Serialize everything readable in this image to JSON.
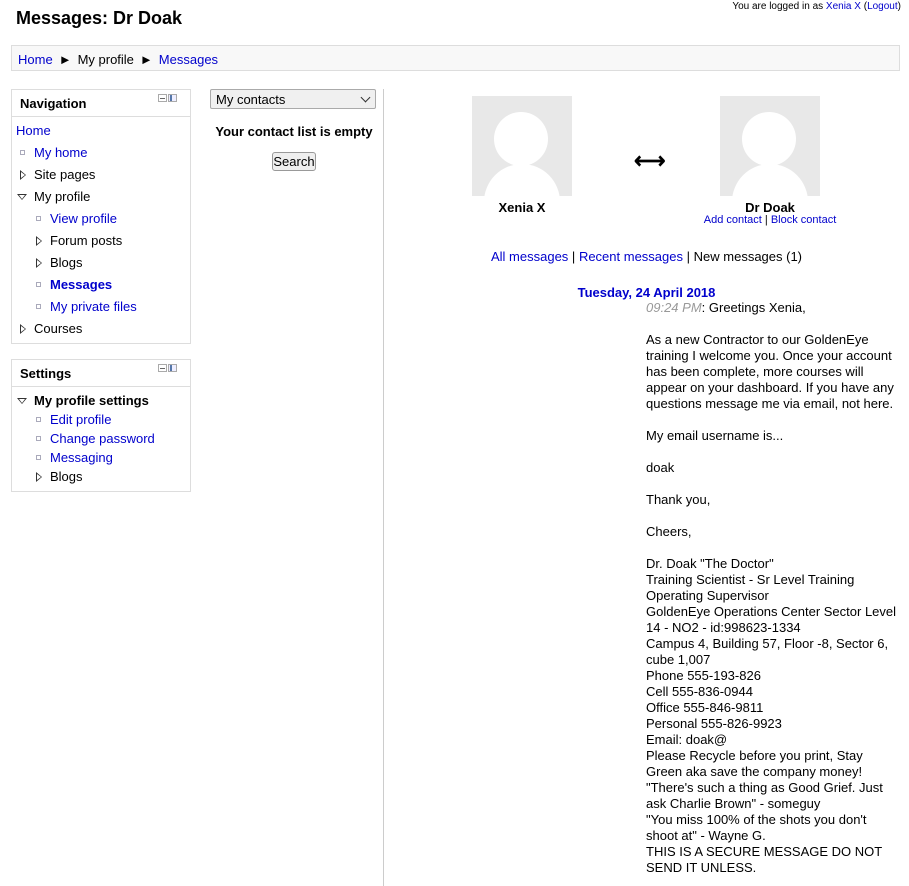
{
  "header": {
    "title": "Messages: Dr Doak",
    "login_prefix": "You are logged in as ",
    "login_user": "Xenia X",
    "logout_label": "Logout"
  },
  "breadcrumb": {
    "home": "Home",
    "separator": "►",
    "profile": "My profile",
    "messages": "Messages"
  },
  "navigation": {
    "title": "Navigation",
    "items": [
      {
        "label": "Home"
      },
      {
        "label": "My home"
      },
      {
        "label": "Site pages"
      },
      {
        "label": "My profile"
      },
      {
        "label": "View profile"
      },
      {
        "label": "Forum posts"
      },
      {
        "label": "Blogs"
      },
      {
        "label": "Messages"
      },
      {
        "label": "My private files"
      },
      {
        "label": "Courses"
      }
    ]
  },
  "settings": {
    "title": "Settings",
    "items": [
      {
        "label": "My profile settings"
      },
      {
        "label": "Edit profile"
      },
      {
        "label": "Change password"
      },
      {
        "label": "Messaging"
      },
      {
        "label": "Blogs"
      }
    ]
  },
  "contacts": {
    "select_value": "My contacts",
    "empty_text": "Your contact list is empty",
    "search_label": "Search"
  },
  "conversation": {
    "left_user": "Xenia X",
    "right_user": "Dr Doak",
    "arrow": "⟷",
    "add_contact": "Add contact",
    "block_contact": "Block contact",
    "link_separator": "|",
    "tab_all": "All messages",
    "tab_recent": "Recent messages",
    "tab_new": "New messages (1)",
    "date": "Tuesday, 24 April 2018"
  },
  "message": {
    "time": "09:24 PM",
    "greeting": ": Greetings Xenia,",
    "para1": "As a new Contractor to our GoldenEye training I welcome you. Once your account has been complete, more courses will appear on your dashboard. If you have any questions message me via email, not here.",
    "para2": "My email username is...",
    "para3": "doak",
    "para4": "Thank you,",
    "para5": "Cheers,",
    "sig1": "Dr. Doak \"The Doctor\"",
    "sig2": "Training Scientist - Sr Level Training Operating Supervisor",
    "sig3": "GoldenEye Operations Center Sector Level 14 - NO2 - id:998623-1334",
    "sig4": "Campus 4, Building 57, Floor -8, Sector 6, cube 1,007",
    "sig5": "Phone 555-193-826",
    "sig6": "Cell 555-836-0944",
    "sig7": "Office 555-846-9811",
    "sig8": "Personal 555-826-9923",
    "sig9": "Email: doak@",
    "sig10": "Please Recycle before you print, Stay Green aka save the company money!",
    "sig11": "\"There's such a thing as Good Grief. Just ask Charlie Brown\" - someguy",
    "sig12": "\"You miss 100% of the shots you don't shoot at\" - Wayne G.",
    "sig13": "THIS IS A SECURE MESSAGE DO NOT SEND IT UNLESS."
  }
}
